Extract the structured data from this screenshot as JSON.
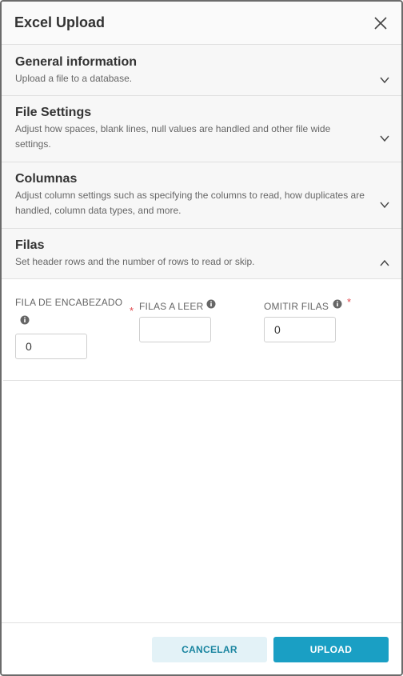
{
  "modal": {
    "title": "Excel Upload"
  },
  "sections": [
    {
      "title": "General information",
      "description": "Upload a file to a database.",
      "expanded": false
    },
    {
      "title": "File Settings",
      "description": "Adjust how spaces, blank lines, null values are handled and other file wide settings.",
      "expanded": false
    },
    {
      "title": "Columnas",
      "description": "Adjust column settings such as specifying the columns to read, how duplicates are handled, column data types, and more.",
      "expanded": false
    },
    {
      "title": "Filas",
      "description": "Set header rows and the number of rows to read or skip.",
      "expanded": true
    }
  ],
  "filas": {
    "header_row": {
      "label": "FILA DE ENCABEZADO",
      "value": "0",
      "required": true
    },
    "rows_to_read": {
      "label": "FILAS A LEER",
      "value": "",
      "required": false
    },
    "skip_rows": {
      "label": "OMITIR FILAS",
      "value": "0",
      "required": true
    }
  },
  "footer": {
    "cancel_label": "CANCELAR",
    "upload_label": "UPLOAD"
  },
  "colors": {
    "accent": "#1a9fc4",
    "cancel_bg": "#e3f2f7",
    "required": "#e0474c"
  }
}
